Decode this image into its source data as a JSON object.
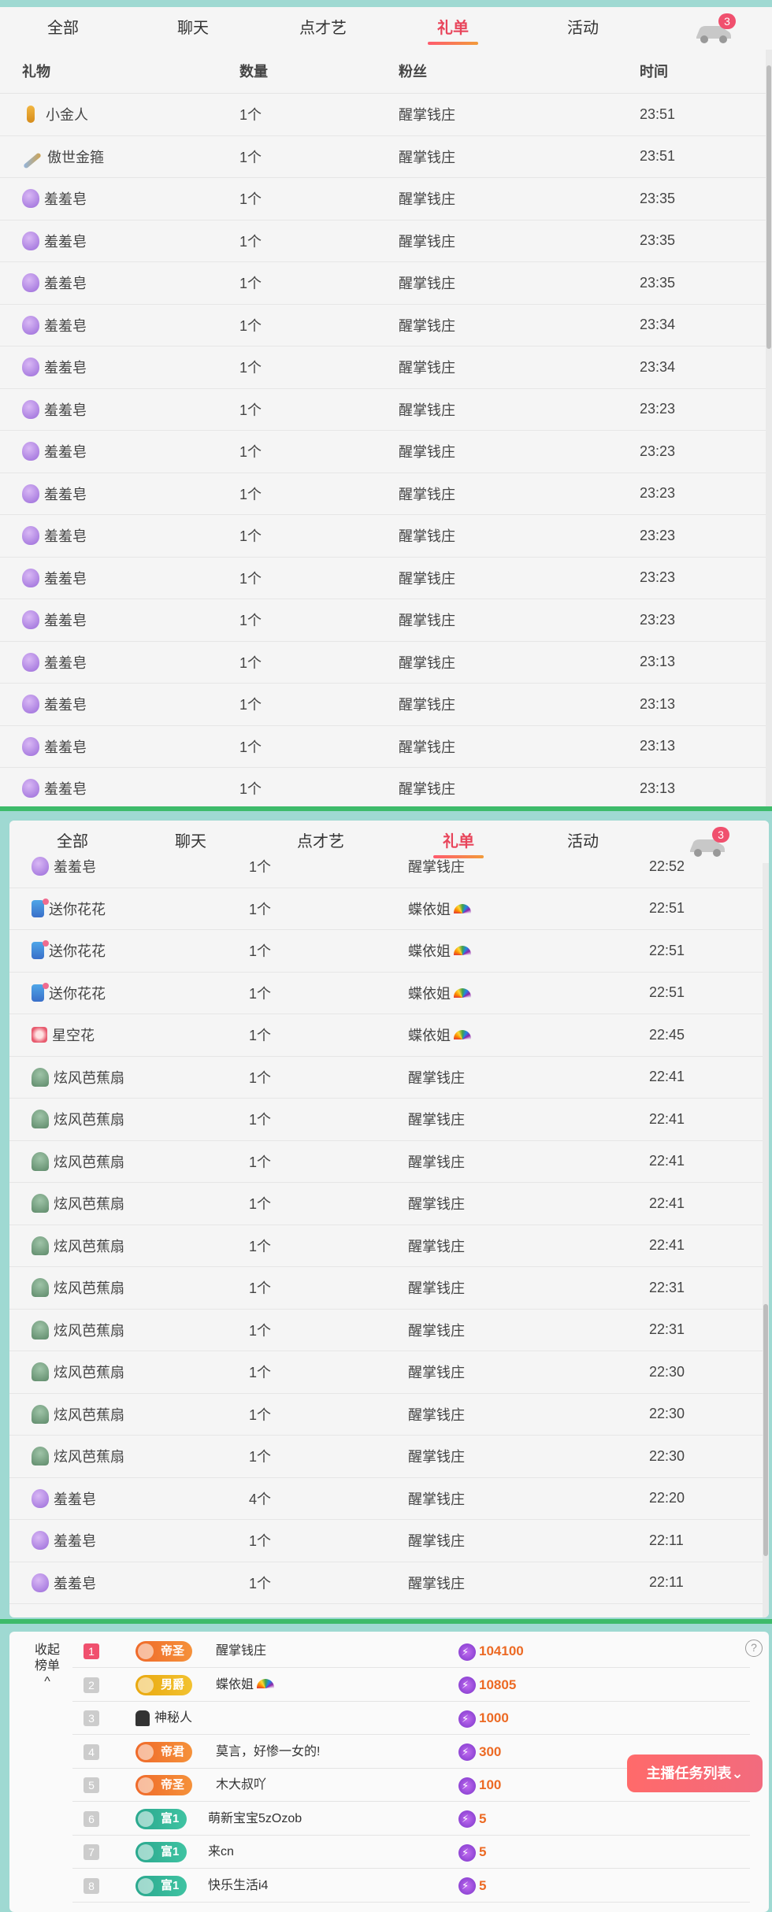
{
  "tabs": [
    "全部",
    "聊天",
    "点才艺",
    "礼单",
    "活动"
  ],
  "active_tab": "礼单",
  "car_badge": "3",
  "table_headers": {
    "gift": "礼物",
    "qty": "数量",
    "fan": "粉丝",
    "time": "时间"
  },
  "panel1_rows": [
    {
      "gift": "小金人",
      "icon": "oscar-icon",
      "qty": "1个",
      "fan": "醒掌钱庄",
      "time": "23:51"
    },
    {
      "gift": "傲世金箍",
      "icon": "golden-staff-icon",
      "qty": "1个",
      "fan": "醒掌钱庄",
      "time": "23:51"
    },
    {
      "gift": "羞羞皂",
      "icon": "soap-icon",
      "qty": "1个",
      "fan": "醒掌钱庄",
      "time": "23:35"
    },
    {
      "gift": "羞羞皂",
      "icon": "soap-icon",
      "qty": "1个",
      "fan": "醒掌钱庄",
      "time": "23:35"
    },
    {
      "gift": "羞羞皂",
      "icon": "soap-icon",
      "qty": "1个",
      "fan": "醒掌钱庄",
      "time": "23:35"
    },
    {
      "gift": "羞羞皂",
      "icon": "soap-icon",
      "qty": "1个",
      "fan": "醒掌钱庄",
      "time": "23:34"
    },
    {
      "gift": "羞羞皂",
      "icon": "soap-icon",
      "qty": "1个",
      "fan": "醒掌钱庄",
      "time": "23:34"
    },
    {
      "gift": "羞羞皂",
      "icon": "soap-icon",
      "qty": "1个",
      "fan": "醒掌钱庄",
      "time": "23:23"
    },
    {
      "gift": "羞羞皂",
      "icon": "soap-icon",
      "qty": "1个",
      "fan": "醒掌钱庄",
      "time": "23:23"
    },
    {
      "gift": "羞羞皂",
      "icon": "soap-icon",
      "qty": "1个",
      "fan": "醒掌钱庄",
      "time": "23:23"
    },
    {
      "gift": "羞羞皂",
      "icon": "soap-icon",
      "qty": "1个",
      "fan": "醒掌钱庄",
      "time": "23:23"
    },
    {
      "gift": "羞羞皂",
      "icon": "soap-icon",
      "qty": "1个",
      "fan": "醒掌钱庄",
      "time": "23:23"
    },
    {
      "gift": "羞羞皂",
      "icon": "soap-icon",
      "qty": "1个",
      "fan": "醒掌钱庄",
      "time": "23:23"
    },
    {
      "gift": "羞羞皂",
      "icon": "soap-icon",
      "qty": "1个",
      "fan": "醒掌钱庄",
      "time": "23:13"
    },
    {
      "gift": "羞羞皂",
      "icon": "soap-icon",
      "qty": "1个",
      "fan": "醒掌钱庄",
      "time": "23:13"
    },
    {
      "gift": "羞羞皂",
      "icon": "soap-icon",
      "qty": "1个",
      "fan": "醒掌钱庄",
      "time": "23:13"
    },
    {
      "gift": "羞羞皂",
      "icon": "soap-icon",
      "qty": "1个",
      "fan": "醒掌钱庄",
      "time": "23:13"
    }
  ],
  "panel2_rows": [
    {
      "gift": "羞羞皂",
      "icon": "soap-icon",
      "qty": "1个",
      "fan": "醒掌钱庄",
      "rainbow": false,
      "time": "22:52"
    },
    {
      "gift": "送你花花",
      "icon": "flower-gift-icon",
      "qty": "1个",
      "fan": "蝶依姐",
      "rainbow": true,
      "time": "22:51"
    },
    {
      "gift": "送你花花",
      "icon": "flower-gift-icon",
      "qty": "1个",
      "fan": "蝶依姐",
      "rainbow": true,
      "time": "22:51"
    },
    {
      "gift": "送你花花",
      "icon": "flower-gift-icon",
      "qty": "1个",
      "fan": "蝶依姐",
      "rainbow": true,
      "time": "22:51"
    },
    {
      "gift": "星空花",
      "icon": "starry-flower-icon",
      "qty": "1个",
      "fan": "蝶依姐",
      "rainbow": true,
      "time": "22:45"
    },
    {
      "gift": "炫风芭蕉扇",
      "icon": "banana-fan-icon",
      "qty": "1个",
      "fan": "醒掌钱庄",
      "rainbow": false,
      "time": "22:41"
    },
    {
      "gift": "炫风芭蕉扇",
      "icon": "banana-fan-icon",
      "qty": "1个",
      "fan": "醒掌钱庄",
      "rainbow": false,
      "time": "22:41"
    },
    {
      "gift": "炫风芭蕉扇",
      "icon": "banana-fan-icon",
      "qty": "1个",
      "fan": "醒掌钱庄",
      "rainbow": false,
      "time": "22:41"
    },
    {
      "gift": "炫风芭蕉扇",
      "icon": "banana-fan-icon",
      "qty": "1个",
      "fan": "醒掌钱庄",
      "rainbow": false,
      "time": "22:41"
    },
    {
      "gift": "炫风芭蕉扇",
      "icon": "banana-fan-icon",
      "qty": "1个",
      "fan": "醒掌钱庄",
      "rainbow": false,
      "time": "22:41"
    },
    {
      "gift": "炫风芭蕉扇",
      "icon": "banana-fan-icon",
      "qty": "1个",
      "fan": "醒掌钱庄",
      "rainbow": false,
      "time": "22:31"
    },
    {
      "gift": "炫风芭蕉扇",
      "icon": "banana-fan-icon",
      "qty": "1个",
      "fan": "醒掌钱庄",
      "rainbow": false,
      "time": "22:31"
    },
    {
      "gift": "炫风芭蕉扇",
      "icon": "banana-fan-icon",
      "qty": "1个",
      "fan": "醒掌钱庄",
      "rainbow": false,
      "time": "22:30"
    },
    {
      "gift": "炫风芭蕉扇",
      "icon": "banana-fan-icon",
      "qty": "1个",
      "fan": "醒掌钱庄",
      "rainbow": false,
      "time": "22:30"
    },
    {
      "gift": "炫风芭蕉扇",
      "icon": "banana-fan-icon",
      "qty": "1个",
      "fan": "醒掌钱庄",
      "rainbow": false,
      "time": "22:30"
    },
    {
      "gift": "羞羞皂",
      "icon": "soap-icon",
      "qty": "4个",
      "fan": "醒掌钱庄",
      "rainbow": false,
      "time": "22:20"
    },
    {
      "gift": "羞羞皂",
      "icon": "soap-icon",
      "qty": "1个",
      "fan": "醒掌钱庄",
      "rainbow": false,
      "time": "22:11"
    },
    {
      "gift": "羞羞皂",
      "icon": "soap-icon",
      "qty": "1个",
      "fan": "醒掌钱庄",
      "rainbow": false,
      "time": "22:11"
    }
  ],
  "ranking": {
    "collapse_label": "收起榜单",
    "collapse_arrow": "^",
    "help": "?",
    "rows": [
      {
        "rank": "1",
        "badge": "帝圣",
        "badge_color": "orange",
        "name": "醒掌钱庄",
        "rainbow": false,
        "mystery": false,
        "score": "104100"
      },
      {
        "rank": "2",
        "badge": "男爵",
        "badge_color": "yellow",
        "name": "蝶依姐",
        "rainbow": true,
        "mystery": false,
        "score": "10805"
      },
      {
        "rank": "3",
        "badge": "",
        "badge_color": "",
        "name": "神秘人",
        "rainbow": false,
        "mystery": true,
        "score": "1000"
      },
      {
        "rank": "4",
        "badge": "帝君",
        "badge_color": "orange",
        "name": "莫言，好惨一女的!",
        "rainbow": false,
        "mystery": false,
        "score": "300"
      },
      {
        "rank": "5",
        "badge": "帝圣",
        "badge_color": "orange",
        "name": "木大叔吖",
        "rainbow": false,
        "mystery": false,
        "score": "100"
      },
      {
        "rank": "6",
        "badge": "富1",
        "badge_color": "green",
        "name": "萌新宝宝5zOzob",
        "rainbow": false,
        "mystery": false,
        "score": "5"
      },
      {
        "rank": "7",
        "badge": "富1",
        "badge_color": "green",
        "name": "来cn",
        "rainbow": false,
        "mystery": false,
        "score": "5"
      },
      {
        "rank": "8",
        "badge": "富1",
        "badge_color": "green",
        "name": "快乐生活i4",
        "rainbow": false,
        "mystery": false,
        "score": "5"
      }
    ]
  },
  "task_button": "主播任务列表",
  "task_arrow": "⌄"
}
